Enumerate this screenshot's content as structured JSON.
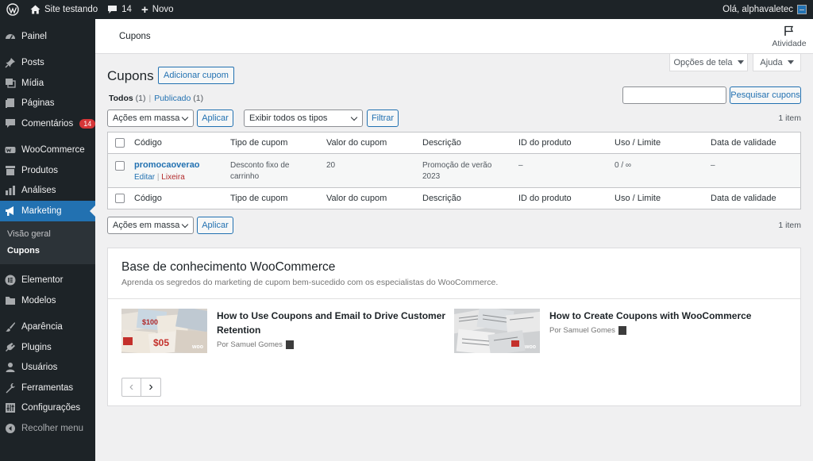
{
  "adminbar": {
    "site_name": "Site testando",
    "comments_count": "14",
    "new_label": "Novo",
    "greeting": "Olá, alphavaletec"
  },
  "sidebar": {
    "items": [
      {
        "label": "Painel",
        "icon": "dashboard-icon"
      },
      {
        "label": "Posts",
        "icon": "pin-icon"
      },
      {
        "label": "Mídia",
        "icon": "media-icon"
      },
      {
        "label": "Páginas",
        "icon": "pages-icon"
      },
      {
        "label": "Comentários",
        "icon": "comments-icon",
        "badge": "14"
      },
      {
        "label": "WooCommerce",
        "icon": "woo-icon"
      },
      {
        "label": "Produtos",
        "icon": "archive-icon"
      },
      {
        "label": "Análises",
        "icon": "chart-icon"
      },
      {
        "label": "Marketing",
        "icon": "megaphone-icon"
      },
      {
        "label": "Elementor",
        "icon": "elementor-icon"
      },
      {
        "label": "Modelos",
        "icon": "folder-icon"
      },
      {
        "label": "Aparência",
        "icon": "brush-icon"
      },
      {
        "label": "Plugins",
        "icon": "plugin-icon"
      },
      {
        "label": "Usuários",
        "icon": "users-icon"
      },
      {
        "label": "Ferramentas",
        "icon": "tools-icon"
      },
      {
        "label": "Configurações",
        "icon": "settings-icon"
      }
    ],
    "submenu": [
      "Visão geral",
      "Cupons"
    ],
    "collapse_label": "Recolher menu"
  },
  "header": {
    "title": "Cupons",
    "activity_label": "Atividade"
  },
  "tabs": {
    "screen_options": "Opções de tela",
    "help": "Ajuda"
  },
  "page": {
    "title": "Cupons",
    "add_button": "Adicionar cupom",
    "filters": {
      "all": "Todos",
      "all_count": "(1)",
      "published": "Publicado",
      "published_count": "(1)",
      "separator": "|"
    },
    "search_placeholder": "",
    "search_button": "Pesquisar cupons",
    "bulk_actions": "Ações em massa",
    "apply": "Aplicar",
    "type_filter": "Exibir todos os tipos",
    "filter_button": "Filtrar",
    "item_count": "1 item"
  },
  "table": {
    "columns": [
      "Código",
      "Tipo de cupom",
      "Valor do cupom",
      "Descrição",
      "ID do produto",
      "Uso / Limite",
      "Data de validade"
    ],
    "rows": [
      {
        "code": "promocaoverao",
        "edit": "Editar",
        "trash": "Lixeira",
        "type": "Desconto fixo de carrinho",
        "amount": "20",
        "description": "Promoção de verão 2023",
        "product_id": "–",
        "usage": "0 / ∞",
        "expiry": "–"
      }
    ]
  },
  "knowledge": {
    "title": "Base de conhecimento WooCommerce",
    "description": "Aprenda os segredos do marketing de cupom bem-sucedido com os especialistas do WooCommerce.",
    "cards": [
      {
        "title": "How to Use Coupons and Email to Drive Customer Retention",
        "author": "Por Samuel Gomes",
        "badge": "woo"
      },
      {
        "title": "How to Create Coupons with WooCommerce",
        "author": "Por Samuel Gomes",
        "badge": "woo"
      }
    ],
    "prev_label": "‹",
    "next_label": "›"
  }
}
